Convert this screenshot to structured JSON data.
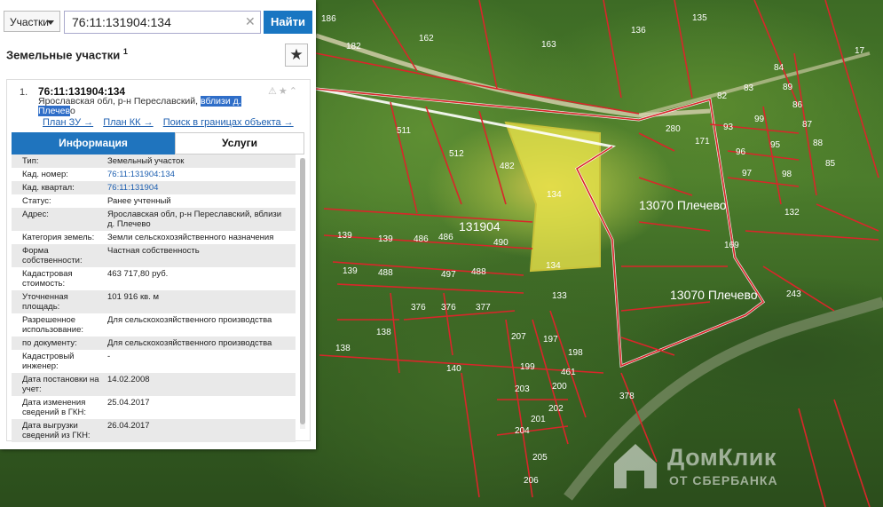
{
  "search": {
    "type_selected": "Участки",
    "query": "76:11:131904:134",
    "find_label": "Найти"
  },
  "section": {
    "title": "Земельные участки",
    "footnote": "1"
  },
  "card": {
    "index": "1.",
    "cadastral": "76:11:131904:134",
    "addr_part1": "Ярославская обл, р-н Переславский,",
    "addr_highlight": "вблизи д. Плечев",
    "addr_part2": "о",
    "links": [
      "План ЗУ →",
      "План КК →",
      "Поиск в границах объекта →"
    ],
    "tabs": {
      "info": "Информация",
      "services": "Услуги"
    }
  },
  "info": [
    {
      "key": "Тип:",
      "value": "Земельный участок"
    },
    {
      "key": "Кад. номер:",
      "value": "76:11:131904:134",
      "link": true
    },
    {
      "key": "Кад. квартал:",
      "value": "76:11:131904",
      "link": true
    },
    {
      "key": "Статус:",
      "value": "Ранее учтенный"
    },
    {
      "key": "Адрес:",
      "value": "Ярославская обл, р-н Переславский, вблизи д. Плечево"
    },
    {
      "key": "Категория земель:",
      "value": "Земли сельскохозяйственного назначения"
    },
    {
      "key": "Форма собственности:",
      "value": "Частная собственность"
    },
    {
      "key": "Кадастровая стоимость:",
      "value": "463 717,80 руб."
    },
    {
      "key": "Уточненная площадь:",
      "value": "101 916 кв. м"
    },
    {
      "key": "Разрешенное использование:",
      "value": "Для сельскохозяйственного производства"
    },
    {
      "key": "по документу:",
      "value": "Для сельскохозяйственного производства"
    },
    {
      "key": "Кадастровый инженер:",
      "value": "-"
    },
    {
      "key": "Дата постановки на учет:",
      "value": "14.02.2008"
    },
    {
      "key": "Дата изменения сведений в ГКН:",
      "value": "25.04.2017"
    },
    {
      "key": "Дата выгрузки сведений из ГКН:",
      "value": "26.04.2017"
    }
  ],
  "map": {
    "plot_labels": [
      "186",
      "162",
      "163",
      "136",
      "135",
      "17",
      "182",
      "511",
      "512",
      "482",
      "134",
      "134",
      "133",
      "139",
      "139",
      "139",
      "131904",
      "486",
      "486",
      "488",
      "490",
      "488",
      "497",
      "376",
      "376",
      "377",
      "138",
      "140",
      "138",
      "280",
      "171",
      "93",
      "96",
      "97",
      "99",
      "95",
      "98",
      "88",
      "85",
      "89",
      "86",
      "82",
      "84",
      "83",
      "87",
      "132",
      "169",
      "13070 Плечево",
      "13070 Плечево",
      "243",
      "378",
      "199",
      "200",
      "201",
      "202",
      "203",
      "204",
      "205",
      "206",
      "207",
      "461",
      "197",
      "198"
    ],
    "highlight_color": "#e8e24a",
    "boundary_color": "#d9262a"
  },
  "watermark": {
    "title": "ДомКлик",
    "subtitle": "ОТ СБЕРБАНКА"
  }
}
